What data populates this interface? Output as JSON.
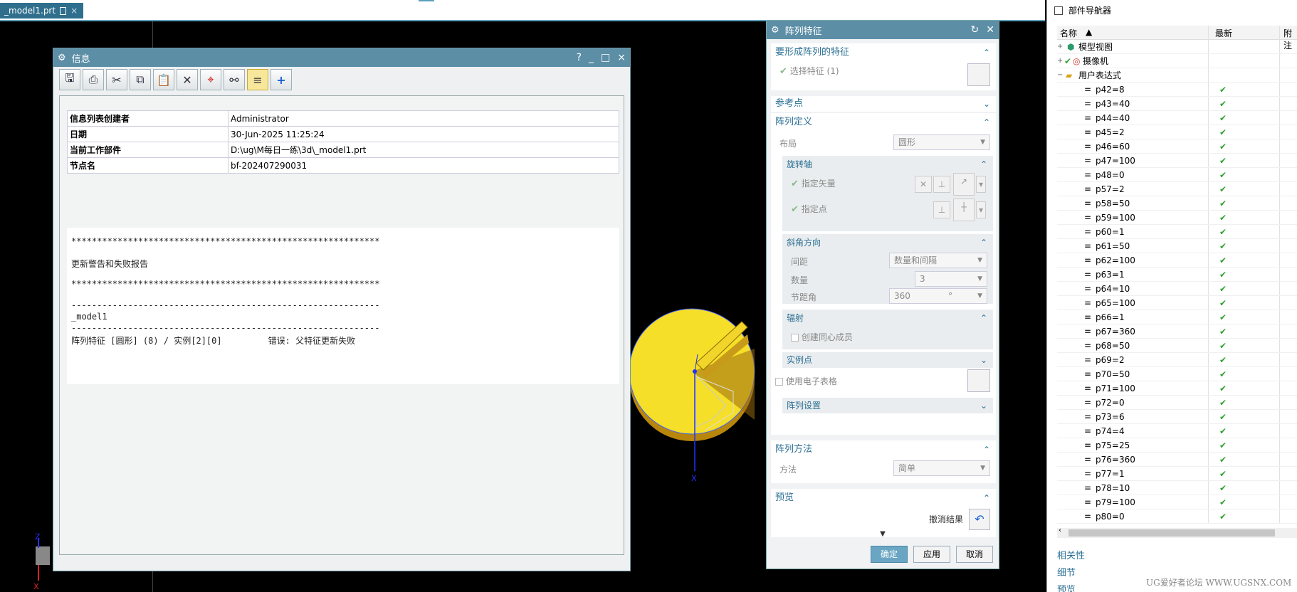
{
  "tabbar": {
    "tab_label": "_model1.prt",
    "close_glyph": "×"
  },
  "info_window": {
    "title": "信息",
    "controls": [
      "?",
      "_",
      "□",
      "×"
    ],
    "toolbar_icons": [
      "save-icon",
      "print-icon",
      "cut-icon",
      "copy-icon",
      "paste-icon",
      "delete-icon",
      "target-icon",
      "binoculars-icon",
      "wrap-icon",
      "plus-icon"
    ],
    "rows": [
      {
        "key": "信息列表创建者",
        "value": "Administrator"
      },
      {
        "key": "日期",
        "value": "30-Jun-2025 11:25:24"
      },
      {
        "key": "当前工作部件",
        "value": "D:\\ug\\M每日一练\\3d\\_model1.prt"
      },
      {
        "key": "节点名",
        "value": "bf-202407290031"
      }
    ],
    "report_lines": [
      "************************************************************",
      "",
      "更新警告和失败报告",
      "",
      "************************************************************",
      "",
      "------------------------------------------------------------",
      "_model1",
      "------------------------------------------------------------",
      "阵列特征 [圆形] (8) / 实例[2][0]         错误: 父特征更新失败"
    ]
  },
  "pattern_dialog": {
    "title": "阵列特征",
    "sec_features": "要形成阵列的特征",
    "select_feature": "选择特征 (1)",
    "sec_reference": "参考点",
    "sec_definition": "阵列定义",
    "layout_label": "布局",
    "layout_value": "圆形",
    "sub_axis": "旋转轴",
    "specify_vector": "指定矢量",
    "specify_point": "指定点",
    "sub_angular": "斜角方向",
    "spacing_label": "间距",
    "spacing_value": "数量和间隔",
    "count_label": "数量",
    "count_value": "3",
    "pitch_label": "节距角",
    "pitch_value": "360",
    "pitch_unit": "°",
    "sub_radiate": "辐射",
    "create_concentric": "创建同心成员",
    "sub_instance": "实例点",
    "use_spreadsheet": "使用电子表格",
    "sub_settings": "阵列设置",
    "sec_method": "阵列方法",
    "method_label": "方法",
    "method_value": "简单",
    "sec_preview": "预览",
    "undo_result": "撤消结果",
    "ok": "确定",
    "apply": "应用",
    "cancel": "取消"
  },
  "navigator": {
    "title": "部件导航器",
    "col_name": "名称",
    "col_latest": "最新",
    "col_attach": "附注",
    "nodes": [
      {
        "label": "模型视图",
        "check": ""
      },
      {
        "label": "摄像机",
        "check": ""
      },
      {
        "label": "用户表达式",
        "check": ""
      }
    ],
    "expressions": [
      "p42=8",
      "p43=40",
      "p44=40",
      "p45=2",
      "p46=60",
      "p47=100",
      "p48=0",
      "p57=2",
      "p58=50",
      "p59=100",
      "p60=1",
      "p61=50",
      "p62=100",
      "p63=1",
      "p64=10",
      "p65=100",
      "p66=1",
      "p67=360",
      "p68=50",
      "p69=2",
      "p70=50",
      "p71=100",
      "p72=0",
      "p73=6",
      "p74=4",
      "p75=25",
      "p76=360",
      "p77=1",
      "p78=10",
      "p79=100",
      "p80=0"
    ],
    "check_glyph": "✔",
    "footer": [
      "相关性",
      "细节",
      "预览"
    ]
  },
  "watermark": "UG爱好者论坛 WWW.UGSNX.COM",
  "axis_labels": {
    "x": "X",
    "z": "Z"
  },
  "colors": {
    "title_bar": "#5c8ea6",
    "accent": "#2b6f93",
    "check": "#2ea12e",
    "part": "#f4d92a"
  }
}
